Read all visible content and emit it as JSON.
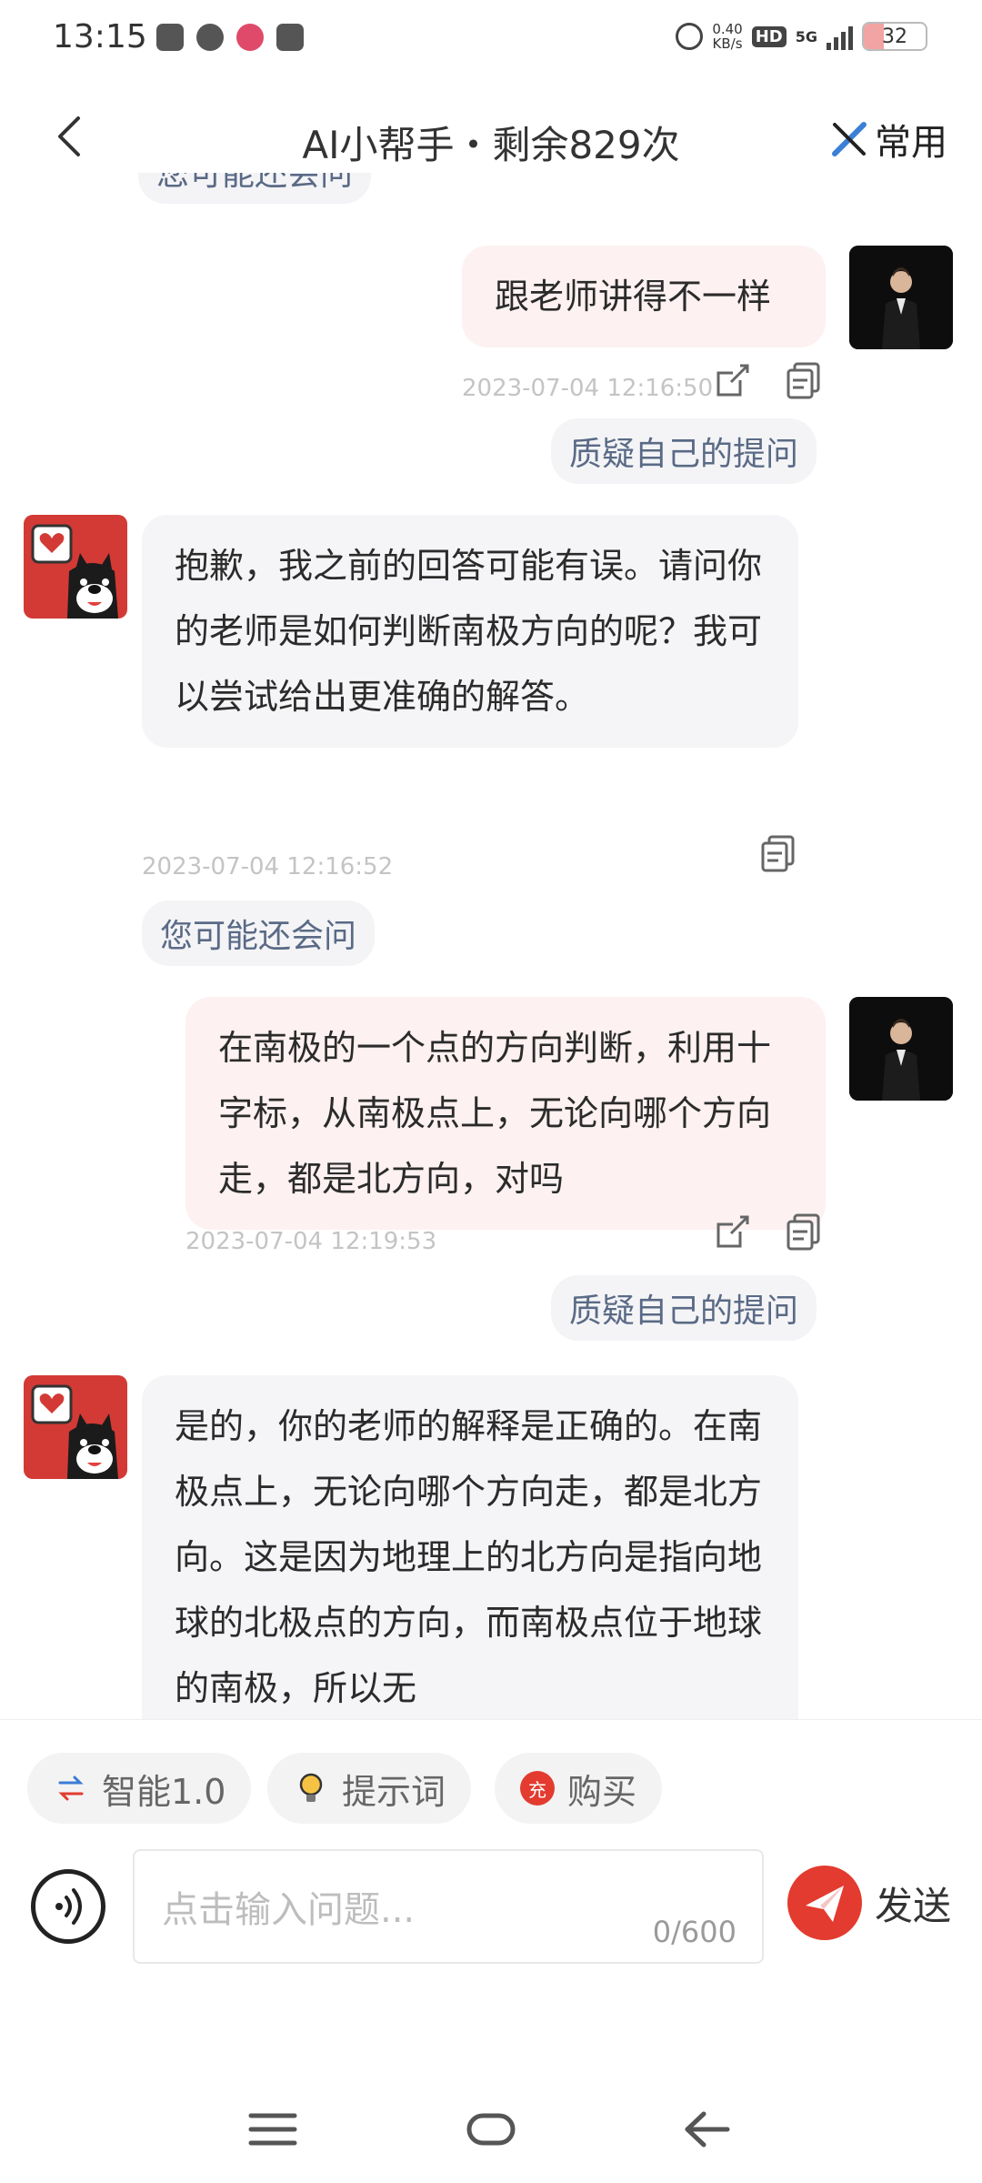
{
  "status_bar": {
    "time": "13:15",
    "net_speed_value": "0.40",
    "net_speed_unit": "KB/s",
    "hd_label": "HD",
    "network_label": "5G",
    "battery_level": "32",
    "battery_fraction": 0.32
  },
  "header": {
    "title": "AI小帮手・剩余829次",
    "common_label": "常用"
  },
  "chat": {
    "top_chip_partial": "您可能还会问",
    "messages": [
      {
        "role": "user",
        "text": "跟老师讲得不一样",
        "timestamp": "2023-07-04 12:16:50",
        "action_chip": "质疑自己的提问"
      },
      {
        "role": "ai",
        "text": "抱歉，我之前的回答可能有误。请问你的老师是如何判断南极方向的呢？我可以尝试给出更准确的解答。",
        "timestamp": "2023-07-04 12:16:52",
        "followup_chip": "您可能还会问"
      },
      {
        "role": "user",
        "text": "在南极的一个点的方向判断，利用十字标，从南极点上，无论向哪个方向走，都是北方向，对吗",
        "timestamp": "2023-07-04 12:19:53",
        "action_chip": "质疑自己的提问"
      },
      {
        "role": "ai",
        "text": "是的，你的老师的解释是正确的。在南极点上，无论向哪个方向走，都是北方向。这是因为地理上的北方向是指向地球的北极点的方向，而南极点位于地球的南极，所以无"
      }
    ]
  },
  "composer": {
    "mode_label": "智能1.0",
    "prompt_label": "提示词",
    "buy_badge": "充",
    "buy_label": "购买",
    "input_placeholder": "点击输入问题...",
    "char_count": "0/600",
    "send_label": "发送"
  },
  "colors": {
    "accent_red": "#e33b2f",
    "chip_text": "#5a6a86",
    "user_bubble": "#fdf1f1",
    "ai_bubble": "#f5f5f7"
  },
  "icons": [
    "back-arrow-icon",
    "pencil-ruler-icon",
    "share-icon",
    "copy-icon",
    "refresh-icon",
    "lightbulb-icon",
    "voice-icon",
    "send-plane-icon",
    "menu-icon",
    "home-icon",
    "nav-back-icon"
  ]
}
